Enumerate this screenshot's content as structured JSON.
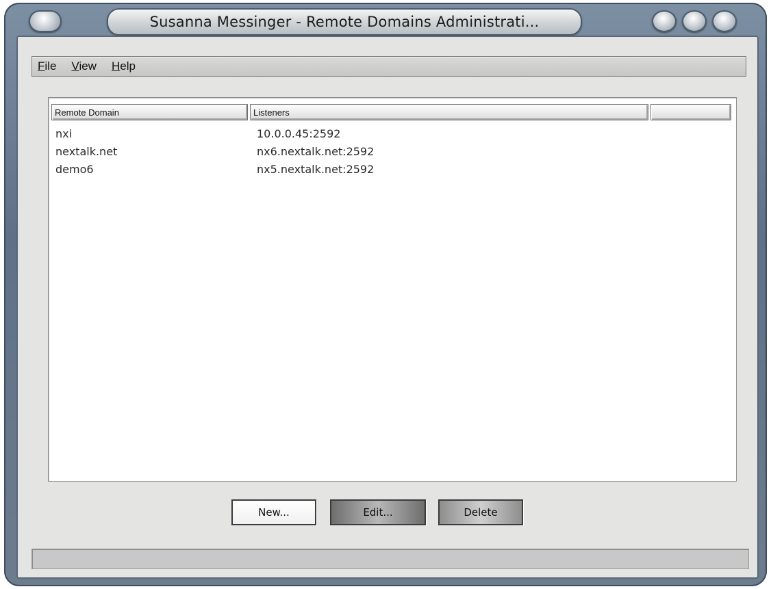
{
  "window": {
    "title": "Susanna Messinger - Remote Domains Administrati..."
  },
  "menu": {
    "items": [
      {
        "mnemonic": "F",
        "rest": "ile"
      },
      {
        "mnemonic": "V",
        "rest": "iew"
      },
      {
        "mnemonic": "H",
        "rest": "elp"
      }
    ]
  },
  "table": {
    "columns": [
      "Remote Domain",
      "Listeners",
      ""
    ],
    "rows": [
      {
        "domain": "nxi",
        "listener": "10.0.0.45:2592"
      },
      {
        "domain": "nextalk.net",
        "listener": "nx6.nextalk.net:2592"
      },
      {
        "domain": "demo6",
        "listener": "nx5.nextalk.net:2592"
      }
    ]
  },
  "buttons": {
    "new": "New...",
    "edit": "Edit...",
    "delete": "Delete"
  },
  "icons": {
    "system_menu": "system-menu-orb-icon",
    "minimize": "minimize-orb-icon",
    "maximize": "maximize-orb-icon",
    "close": "close-orb-icon"
  },
  "colors": {
    "frame": "#5f7186",
    "client_bg": "#e4e4e2",
    "list_bg": "#ffffff"
  },
  "statusbar": {
    "text": ""
  }
}
